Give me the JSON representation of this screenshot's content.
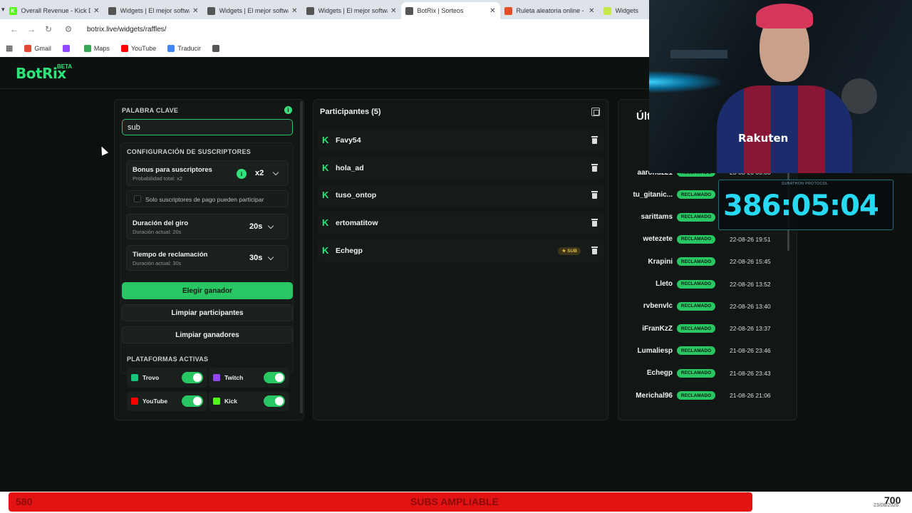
{
  "browser": {
    "tabs": [
      {
        "title": "Overall Revenue - Kick Da",
        "color": "#53fc18",
        "glyph": "K",
        "active": false
      },
      {
        "title": "Widgets | El mejor softwa",
        "color": "#555555",
        "glyph": "",
        "active": false
      },
      {
        "title": "Widgets | El mejor softwa",
        "color": "#555555",
        "glyph": "",
        "active": false
      },
      {
        "title": "Widgets | El mejor softwa",
        "color": "#555555",
        "glyph": "",
        "active": false
      },
      {
        "title": "BotRix | Sorteos",
        "color": "#555555",
        "glyph": "",
        "active": true
      },
      {
        "title": "Ruleta aleatoria online - ",
        "color": "#e44d26",
        "glyph": "",
        "active": false
      },
      {
        "title": "Widgets",
        "color": "#c6e84a",
        "glyph": "",
        "active": false
      }
    ],
    "url": "botrix.live/widgets/raffles/",
    "bookmarks": [
      {
        "label": "Gmail",
        "color": "#ea4335"
      },
      {
        "label": "",
        "color": "#9146ff"
      },
      {
        "label": "Maps",
        "color": "#34a853"
      },
      {
        "label": "YouTube",
        "color": "#ff0000"
      },
      {
        "label": "Traducir",
        "color": "#4285f4"
      },
      {
        "label": "",
        "color": "#555555"
      }
    ]
  },
  "app": {
    "logo": "BotRix",
    "badge": "BETA"
  },
  "settings": {
    "keyword_label": "PALABRA CLAVE",
    "keyword_value": "sub",
    "sub_config_label": "CONFIGURACIÓN DE SUSCRIPTORES",
    "bonus_title": "Bonus para suscriptores",
    "bonus_sub": "Probabilidad total: x2",
    "bonus_value": "x2",
    "only_paid_label": "Solo suscriptores de pago pueden participar",
    "spin_title": "Duración del giro",
    "spin_sub": "Duración actual: 20s",
    "spin_value": "20s",
    "claim_title": "Tiempo de reclamación",
    "claim_sub": "Duración actual: 30s",
    "claim_value": "30s",
    "pick_winner": "Elegir ganador",
    "clear_participants": "Limpiar participantes",
    "clear_winners": "Limpiar ganadores",
    "platforms_label": "PLATAFORMAS ACTIVAS",
    "platforms": [
      {
        "name": "Trovo",
        "color": "#1bc47d",
        "enabled": true
      },
      {
        "name": "Twitch",
        "color": "#9146ff",
        "enabled": true
      },
      {
        "name": "YouTube",
        "color": "#ff0000",
        "enabled": true
      },
      {
        "name": "Kick",
        "color": "#53fc18",
        "enabled": true
      }
    ]
  },
  "participants": {
    "title": "Participantes (5)",
    "items": [
      {
        "name": "Favy54",
        "sub": false
      },
      {
        "name": "hola_ad",
        "sub": false
      },
      {
        "name": "tuso_ontop",
        "sub": false
      },
      {
        "name": "ertomatitow",
        "sub": false
      },
      {
        "name": "Echegp",
        "sub": true
      }
    ],
    "sub_badge": "SUB"
  },
  "winners": {
    "title": "Últ",
    "badge": "RECLAMADO",
    "items": [
      {
        "name": "aaronuz21",
        "date": "23-08-26 00:00"
      },
      {
        "name": "tu_gitanic...",
        "date": ""
      },
      {
        "name": "sarittams",
        "date": ""
      },
      {
        "name": "wetezete",
        "date": "22-08-26 19:51"
      },
      {
        "name": "Krapini",
        "date": "22-08-26 15:45"
      },
      {
        "name": "Lleto",
        "date": "22-08-26 13:52"
      },
      {
        "name": "rvbenvlc",
        "date": "22-08-26 13:40"
      },
      {
        "name": "iFranKzZ",
        "date": "22-08-26 13:37"
      },
      {
        "name": "Lumaliesp",
        "date": "21-08-26 23:46"
      },
      {
        "name": "Echegp",
        "date": "21-08-26 23:43"
      },
      {
        "name": "Merichal96",
        "date": "21-08-26 21:06"
      }
    ]
  },
  "overlay": {
    "timer": "386:05:04",
    "timer_label": "SUBATHON PROTOCOL",
    "camera_shirt_text": "Rakuten",
    "bar_left": "580",
    "bar_center": "SUBS AMPLIABLE",
    "bar_right": "700",
    "bar_date": "23/08/2026"
  }
}
